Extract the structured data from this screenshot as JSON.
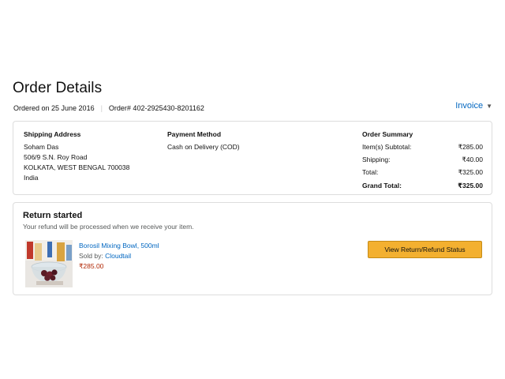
{
  "page": {
    "title": "Order Details",
    "ordered_on": "Ordered on 25 June 2016",
    "order_number": "Order# 402-2925430-8201162",
    "invoice_label": "Invoice"
  },
  "shipping": {
    "heading": "Shipping Address",
    "lines": [
      "Soham Das",
      "506/9 S.N. Roy Road",
      "KOLKATA, WEST BENGAL 700038",
      "India"
    ]
  },
  "payment": {
    "heading": "Payment Method",
    "method": "Cash on Delivery (COD)"
  },
  "summary": {
    "heading": "Order Summary",
    "rows": [
      {
        "label": "Item(s) Subtotal:",
        "value": "₹285.00"
      },
      {
        "label": "Shipping:",
        "value": "₹40.00"
      },
      {
        "label": "Total:",
        "value": "₹325.00"
      },
      {
        "label": "Grand Total:",
        "value": "₹325.00"
      }
    ]
  },
  "return": {
    "title": "Return started",
    "subtitle": "Your refund will be processed when we receive your item.",
    "item_name": "Borosil Mixing Bowl, 500ml",
    "sold_by_label": "Sold by:",
    "seller": "Cloudtail",
    "price": "₹285.00",
    "button_label": "View Return/Refund Status"
  },
  "colors": {
    "link": "#0066c0",
    "price": "#B12704",
    "button": "#f3b030"
  }
}
